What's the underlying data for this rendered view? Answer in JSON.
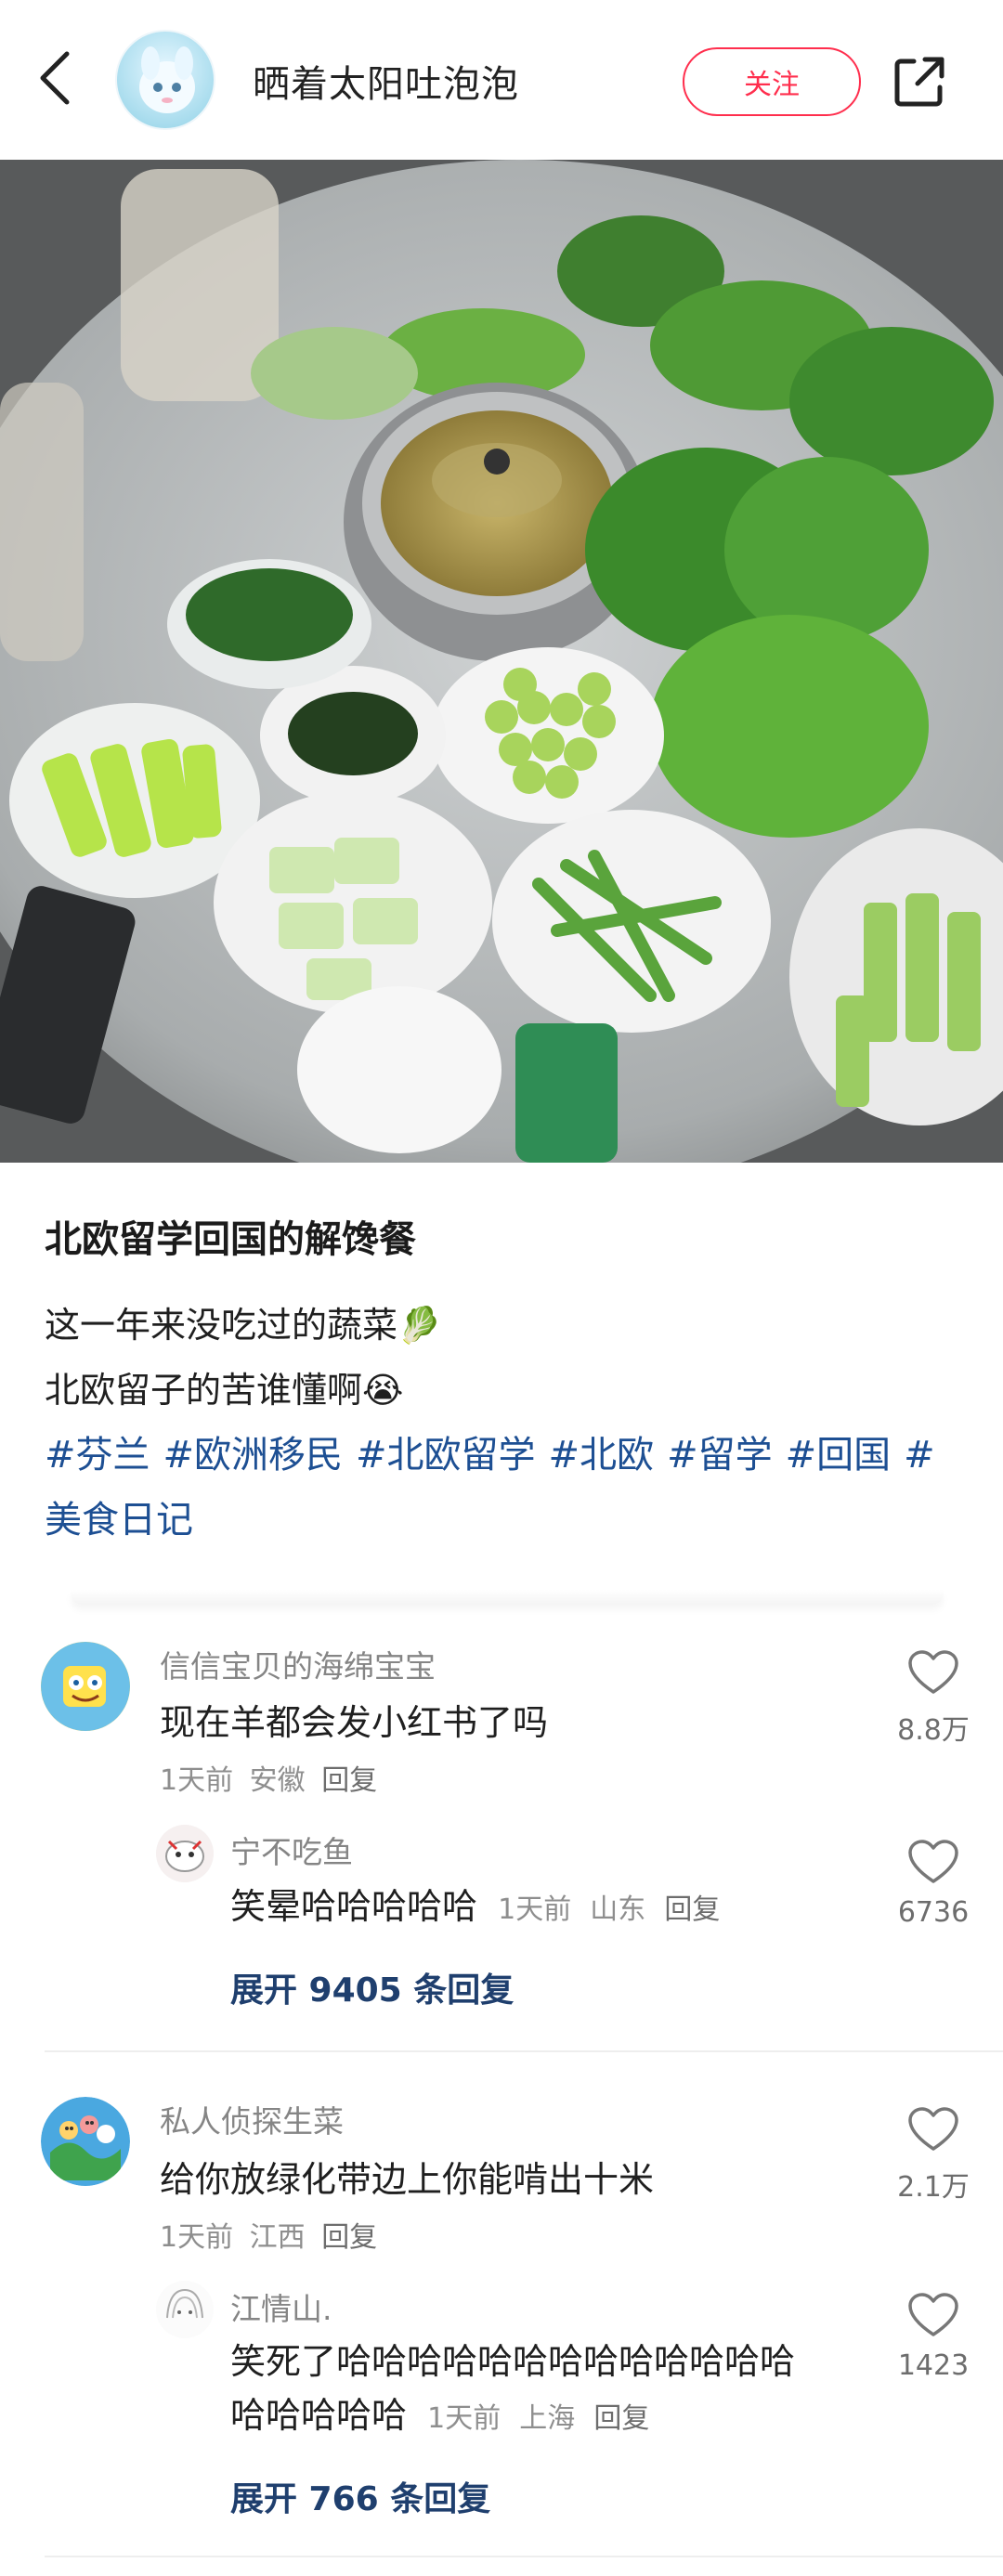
{
  "header": {
    "author_name": "晒着太阳吐泡泡",
    "follow_label": "关注"
  },
  "post": {
    "title": "北欧留学回国的解馋餐",
    "line1": "这一年来没吃过的蔬菜🥬",
    "line2": "北欧留子的苦谁懂啊😭",
    "tags": [
      "#芬兰",
      "#欧洲移民",
      "#北欧留学",
      "#北欧",
      "#留学",
      "#回国",
      "#美食日记"
    ]
  },
  "comments": [
    {
      "user": "信信宝贝的海绵宝宝",
      "text": "现在羊都会发小红书了吗",
      "time": "1天前",
      "location": "安徽",
      "reply_label": "回复",
      "likes": "8.8万",
      "reply": {
        "user": "宁不吃鱼",
        "text": "笑晕哈哈哈哈哈",
        "time": "1天前",
        "location": "山东",
        "reply_label": "回复",
        "likes": "6736"
      },
      "expand_label": "展开 9405 条回复"
    },
    {
      "user": "私人侦探生菜",
      "text": "给你放绿化带边上你能啃出十米",
      "time": "1天前",
      "location": "江西",
      "reply_label": "回复",
      "likes": "2.1万",
      "reply": {
        "user": "江情山.",
        "text_line1": "笑死了哈哈哈哈哈哈哈哈哈哈哈哈哈",
        "text_line2": "哈哈哈哈哈",
        "time": "1天前",
        "location": "上海",
        "reply_label": "回复",
        "likes": "1423"
      },
      "expand_label": "展开 766 条回复"
    }
  ],
  "icons": {
    "back": "back-arrow-icon",
    "share": "share-icon",
    "like": "heart-outline-icon"
  },
  "colors": {
    "accent": "#ff2e4d",
    "tag": "#1d4f93",
    "expand": "#1f3f6e"
  }
}
